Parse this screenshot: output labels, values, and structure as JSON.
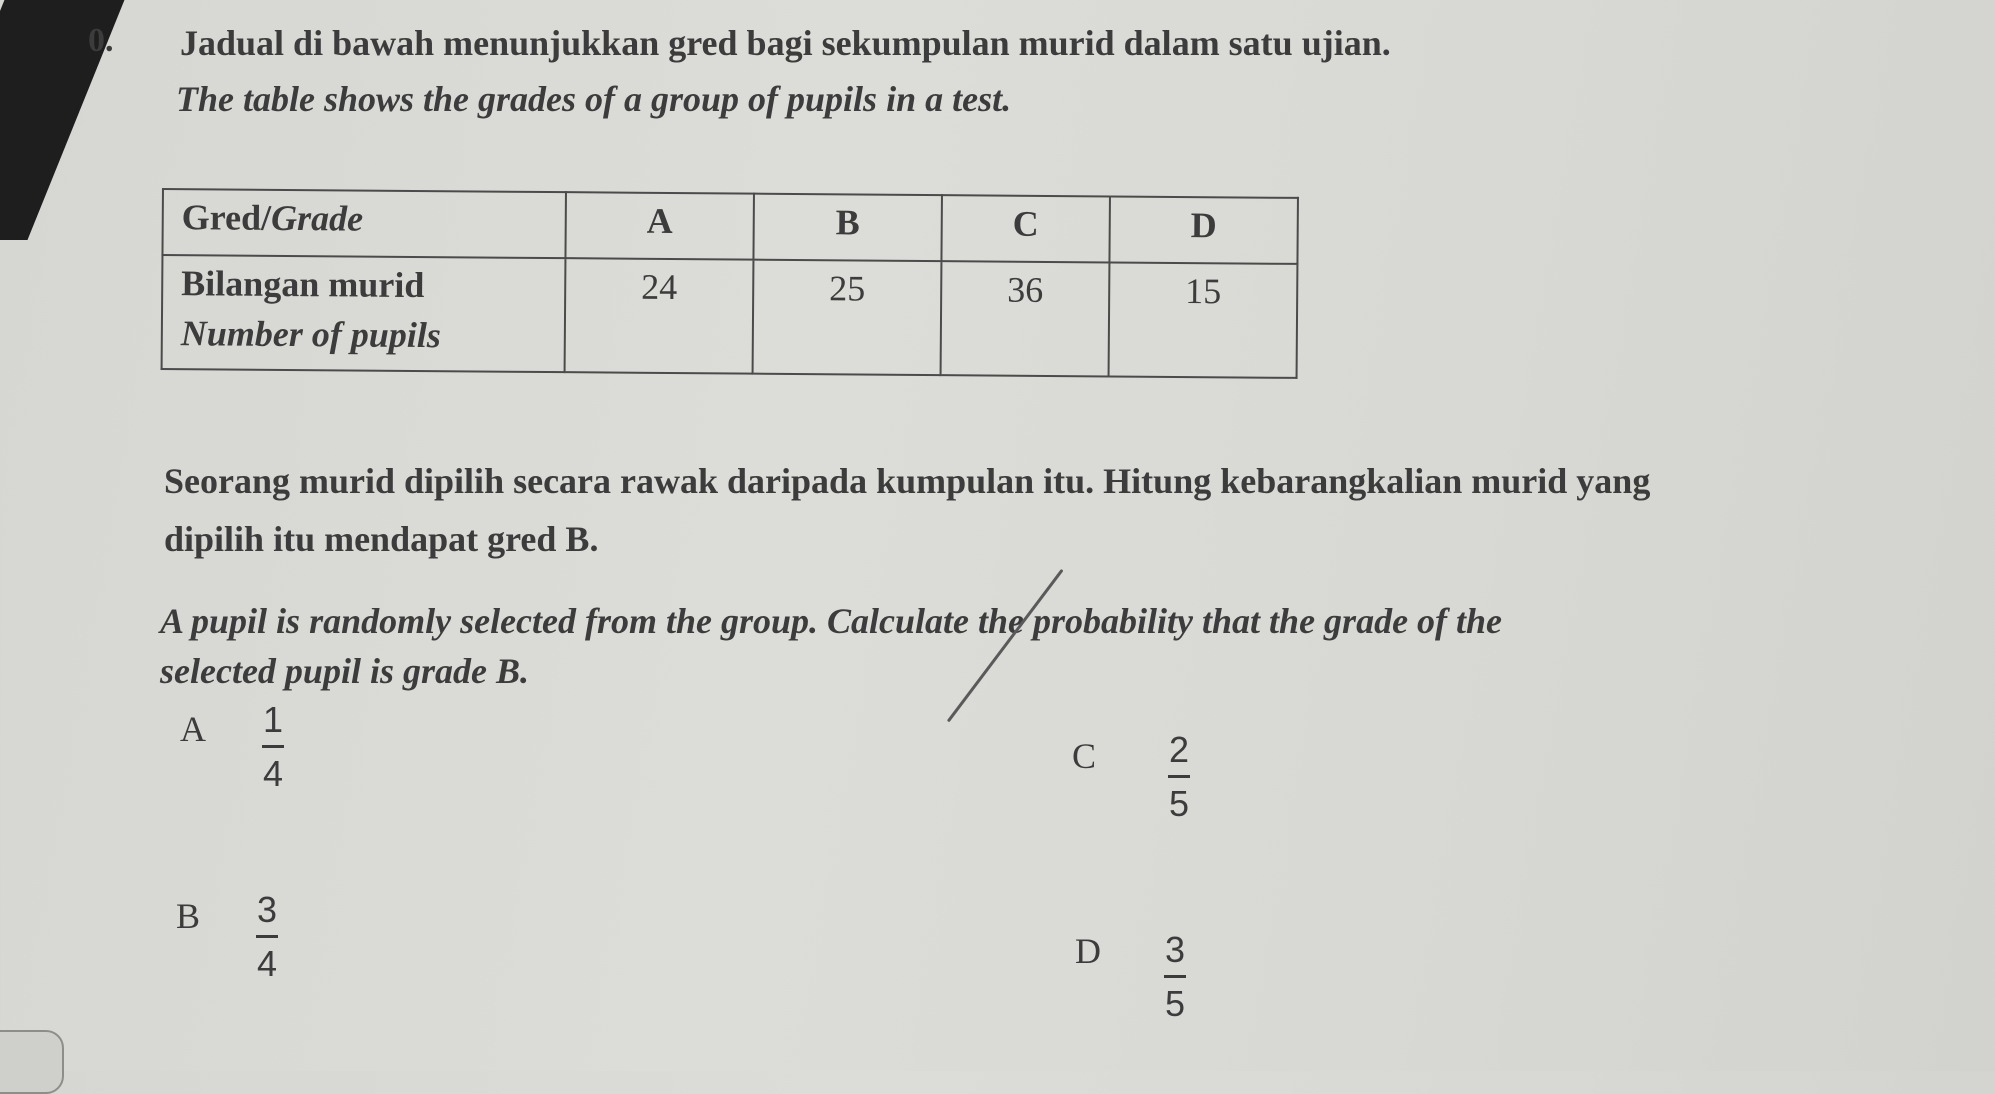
{
  "question": {
    "number": "0.",
    "intro_malay": "Jadual di bawah menunjukkan gred bagi sekumpulan murid dalam satu ujian.",
    "intro_english": "The table shows the grades of a group of pupils in a test."
  },
  "table": {
    "header_label_malay": "Gred/",
    "header_label_english": "Grade",
    "grades": [
      "A",
      "B",
      "C",
      "D"
    ],
    "row_label_malay": "Bilangan murid",
    "row_label_english": "Number of pupils",
    "counts": [
      "24",
      "25",
      "36",
      "15"
    ]
  },
  "prompt": {
    "malay_line1": "Seorang murid dipilih secara rawak daripada kumpulan itu. Hitung kebarangkalian murid yang",
    "malay_line2": "dipilih itu mendapat gred B.",
    "english_line1": "A pupil is randomly selected from the group. Calculate the probability that the grade of the",
    "english_line2": "selected pupil is grade B."
  },
  "options": [
    {
      "letter": "A",
      "numerator": "1",
      "denominator": "4"
    },
    {
      "letter": "B",
      "numerator": "3",
      "denominator": "4"
    },
    {
      "letter": "C",
      "numerator": "2",
      "denominator": "5",
      "handwritten_mark": "slash"
    },
    {
      "letter": "D",
      "numerator": "3",
      "denominator": "5"
    }
  ]
}
